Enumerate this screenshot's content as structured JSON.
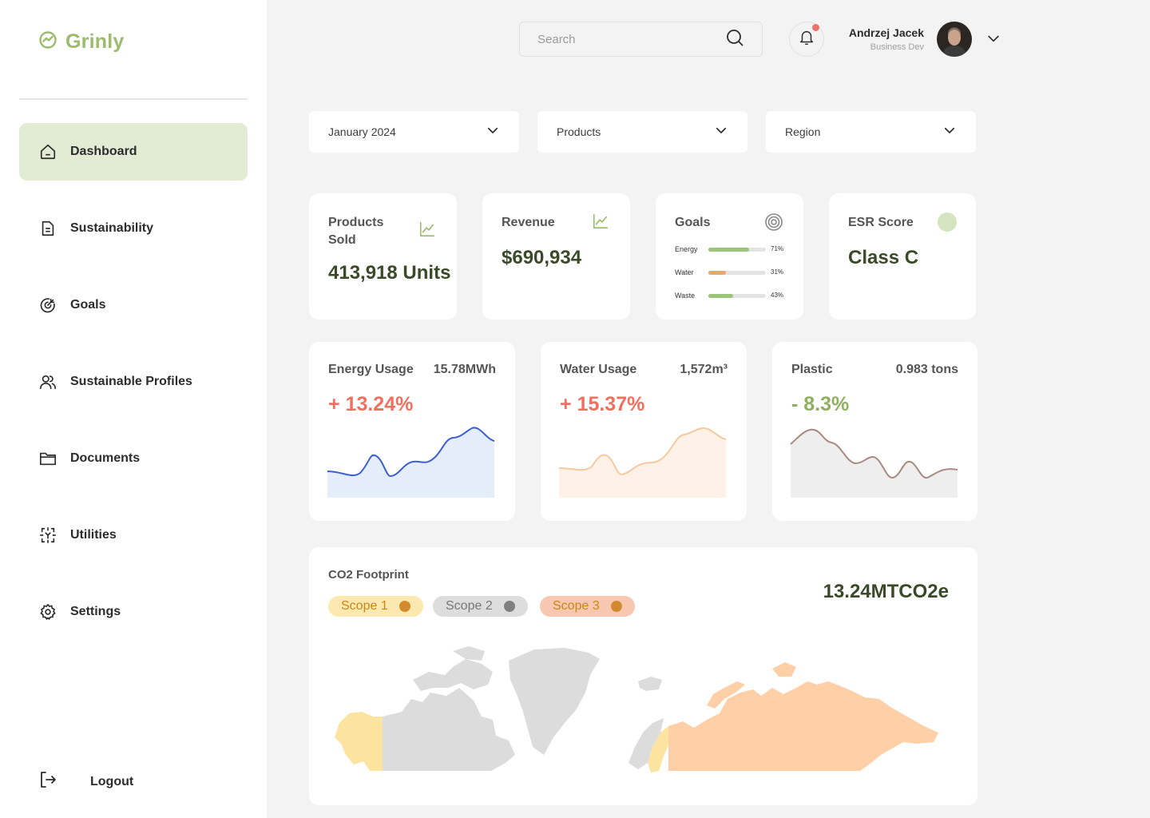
{
  "brand": {
    "name": "Grinly",
    "color": "#9dbb6c"
  },
  "sidebar": {
    "items": [
      {
        "label": "Dashboard",
        "icon": "home-icon",
        "active": true
      },
      {
        "label": "Sustainability",
        "icon": "document-icon"
      },
      {
        "label": "Goals",
        "icon": "target-icon"
      },
      {
        "label": "Sustainable Profiles",
        "icon": "users-icon"
      },
      {
        "label": "Documents",
        "icon": "folder-icon"
      },
      {
        "label": "Utilities",
        "icon": "utilities-icon"
      },
      {
        "label": "Settings",
        "icon": "gear-icon"
      }
    ],
    "logout": "Logout"
  },
  "header": {
    "search_placeholder": "Search",
    "user": {
      "name": "Andrzej Jacek",
      "role": "Business Dev"
    },
    "notification_dot_color": "#f07070"
  },
  "filters": [
    {
      "label": "January 2024"
    },
    {
      "label": "Products"
    },
    {
      "label": "Region"
    }
  ],
  "stats": {
    "products_sold": {
      "title": "Products Sold",
      "value": "413,918 Units"
    },
    "revenue": {
      "title": "Revenue",
      "value": "$690,934"
    },
    "goals": {
      "title": "Goals",
      "items": [
        {
          "label": "Energy",
          "percent": 71,
          "display": "71%",
          "color": "#9cc479"
        },
        {
          "label": "Water",
          "percent": 31,
          "display": "31%",
          "color": "#f0a36e"
        },
        {
          "label": "Waste",
          "percent": 43,
          "display": "43%",
          "color": "#9cc479"
        }
      ]
    },
    "esr": {
      "title": "ESR Score",
      "value": "Class C",
      "dot_color": "#d5e4c0"
    }
  },
  "usage": [
    {
      "title": "Energy Usage",
      "amount": "15.78MWh",
      "change": "+ 13.24%",
      "change_color": "#f07060",
      "line_color": "#3c5fd0",
      "fill_color": "#dce6f8"
    },
    {
      "title": "Water Usage",
      "amount": "1,572m³",
      "change": "+ 15.37%",
      "change_color": "#f07060",
      "line_color": "#f5c9a0",
      "fill_color": "#fdece0"
    },
    {
      "title": "Plastic",
      "amount": "0.983 tons",
      "change": "- 8.3%",
      "change_color": "#8fb060",
      "line_color": "#a88a82",
      "fill_color": "#e8e8e8"
    }
  ],
  "co2": {
    "title": "CO2 Footprint",
    "value": "13.24MTCO2e",
    "scopes": [
      {
        "label": "Scope 1",
        "bg": "#fde8b0",
        "text": "#c8861a",
        "dot": "#d38a2e"
      },
      {
        "label": "Scope 2",
        "bg": "#dddddd",
        "text": "#777777",
        "dot": "#808080"
      },
      {
        "label": "Scope 3",
        "bg": "#f8c7b0",
        "text": "#c8861a",
        "dot": "#d38a2e"
      }
    ],
    "map_colors": {
      "scope1": "#fde3a0",
      "scope2": "#dcdcdc",
      "scope3": "#ffcfa8"
    }
  }
}
